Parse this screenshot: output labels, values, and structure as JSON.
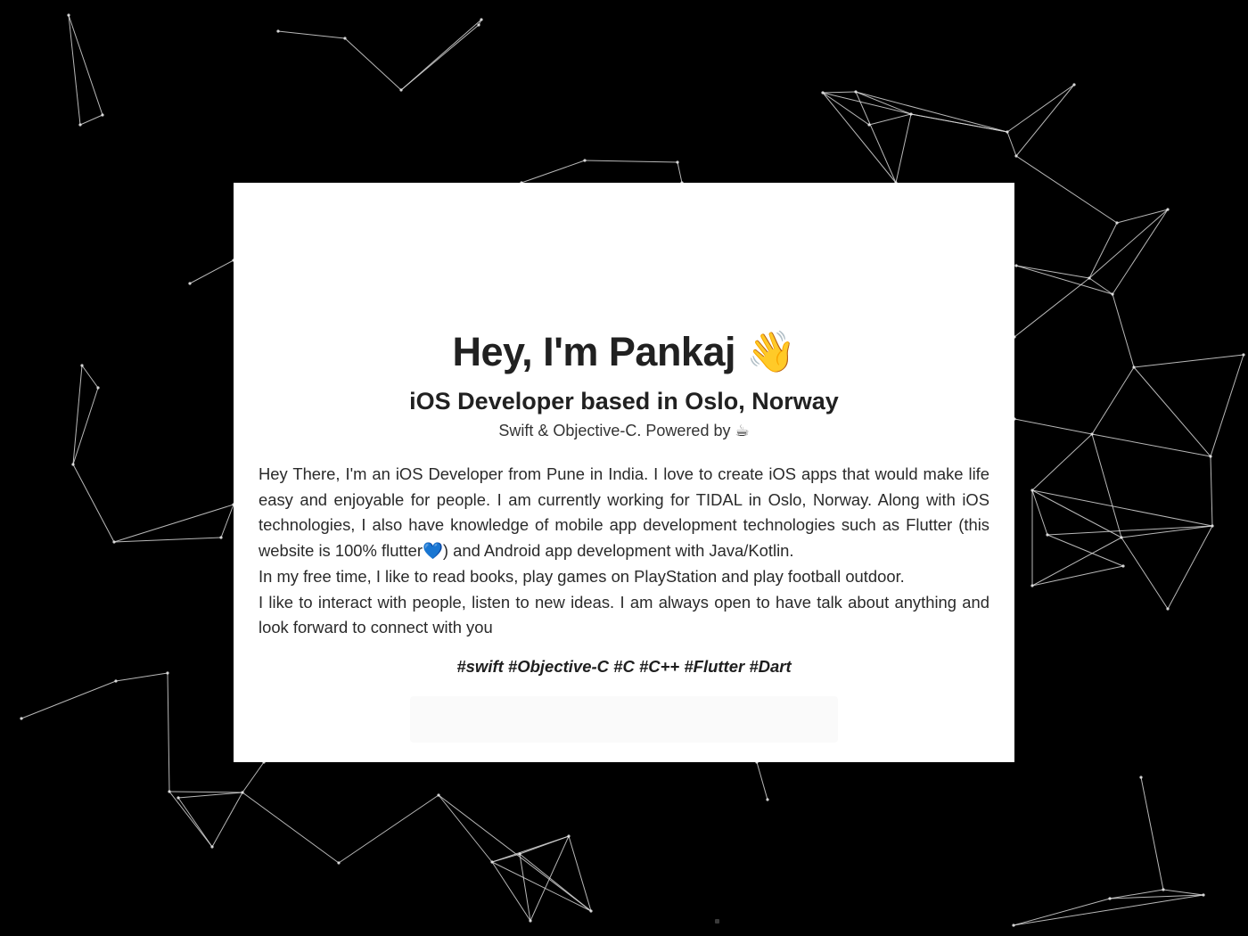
{
  "profile": {
    "title": "Hey, I'm Pankaj 👋",
    "subtitle": "iOS Developer based in Oslo, Norway",
    "tagline": "Swift & Objective-C. Powered by ☕",
    "about": [
      "Hey There, I'm an iOS Developer from Pune in India. I love to create iOS apps that would make life easy and enjoyable for people. I am currently working for TIDAL in Oslo, Norway. Along with iOS technologies, I also have knowledge of mobile app development technologies such as Flutter (this website is 100% flutter💙) and Android app development with Java/Kotlin.",
      "In my free time, I like to read books, play games on PlayStation and play football outdoor.",
      "I like to interact with people, listen to new ideas. I am always open to have talk about anything and look forward to connect with you"
    ],
    "hashtags": "#swift #Objective-C #C #C++ #Flutter #Dart"
  },
  "colors": {
    "background": "#000000",
    "card": "#ffffff",
    "network_lines": "#d9d9d9",
    "text": "#212121"
  }
}
